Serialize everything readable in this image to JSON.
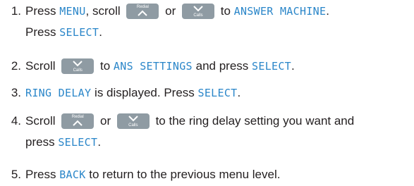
{
  "steps": [
    {
      "num": "1.",
      "scroll": "Press",
      "menu": "MENU",
      "scroll2": ", scroll",
      "or": "or",
      "to": "to",
      "answer_machine": "ANSWER MACHINE",
      "period": ".",
      "press": "Press",
      "select": "SELECT",
      "end": "."
    },
    {
      "num": "2.",
      "scroll": "Scroll",
      "to": "to",
      "ans_settings": "ANS SETTINGS",
      "and_press": "and press",
      "select": "SELECT",
      "end": "."
    },
    {
      "num": "3.",
      "ring_delay": "RING DELAY",
      "is_displayed": "is displayed. Press",
      "select": "SELECT",
      "end": "."
    },
    {
      "num": "4.",
      "scroll": "Scroll",
      "or": "or",
      "rest": "to the ring delay setting you want and",
      "press": "press",
      "select": "SELECT",
      "end": "."
    },
    {
      "num": "5.",
      "press": "Press",
      "back": "BACK",
      "rest": "to return to the previous menu level."
    }
  ],
  "keys": {
    "redial_label": "Redial",
    "calls_label": "Calls"
  },
  "colors": {
    "lcd_text": "#2a86c9",
    "key_bg": "#8f9ba3",
    "body_text": "#231f20"
  }
}
